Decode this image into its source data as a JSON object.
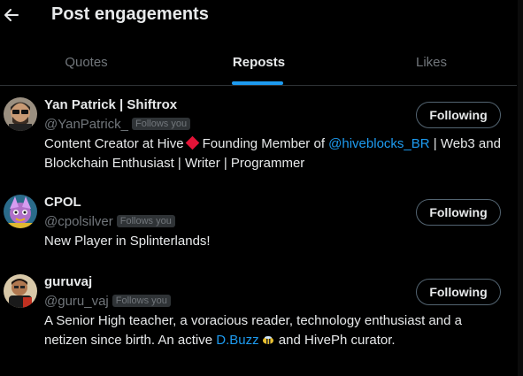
{
  "header": {
    "title": "Post engagements"
  },
  "tabs": [
    {
      "label": "Quotes",
      "active": false
    },
    {
      "label": "Reposts",
      "active": true
    },
    {
      "label": "Likes",
      "active": false
    }
  ],
  "users": [
    {
      "name": "Yan Patrick | Shiftrox",
      "handle": "@YanPatrick_",
      "follows_you": "Follows you",
      "button": "Following",
      "bio_part1": "Content Creator at Hive",
      "bio_part2": "Founding Member of ",
      "bio_link": "@hiveblocks_BR",
      "bio_part3": " | Web3 and Blockchain Enthusiast | Writer | Programmer"
    },
    {
      "name": "CPOL",
      "handle": "@cpolsilver",
      "follows_you": "Follows you",
      "button": "Following",
      "bio": "New Player in Splinterlands!"
    },
    {
      "name": "guruvaj",
      "handle": "@guru_vaj",
      "follows_you": "Follows you",
      "button": "Following",
      "bio_part1": "A Senior High teacher, a voracious reader, technology enthusiast and a netizen since birth. An active ",
      "bio_link": "D.Buzz",
      "bio_part2": " and HivePh curator."
    }
  ],
  "colors": {
    "accent": "#1d9bf0",
    "hive_red": "#e31337",
    "muted": "#71767b"
  }
}
